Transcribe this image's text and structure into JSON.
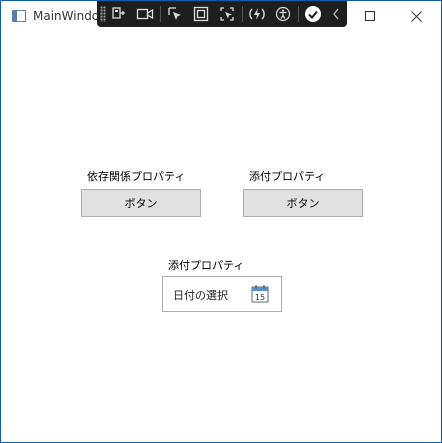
{
  "window": {
    "title": "MainWindow"
  },
  "devtools": {
    "icons": [
      "live-visual-tree-icon",
      "record-icon",
      "select-element-icon",
      "display-layout-adorners-icon",
      "track-focus-icon",
      "hot-reload-icon",
      "accessibility-icon",
      "binding-check-icon",
      "collapse-chevron-icon"
    ]
  },
  "main": {
    "dependency_label": "依存関係プロパティ",
    "dependency_button": "ボタン",
    "attached_label_1": "添付プロパティ",
    "attached_button": "ボタン",
    "attached_label_2": "添付プロパティ",
    "date_placeholder": "日付の選択",
    "calendar_day": "15"
  },
  "colors": {
    "window_border": "#0f5aa6",
    "button_bg": "#e1e1e1",
    "button_border": "#adadad",
    "devbar_bg": "#1e1e1e"
  }
}
